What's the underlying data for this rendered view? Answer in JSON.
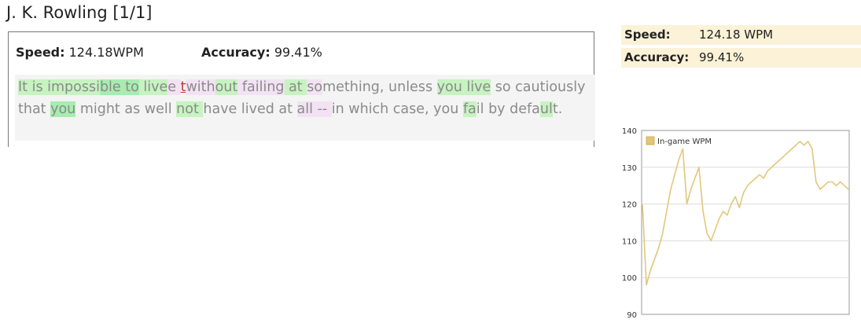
{
  "page": {
    "title": "J. K. Rowling [1/1]"
  },
  "result_panel": {
    "speed_label": "Speed:",
    "speed_value": "124.18WPM",
    "accuracy_label": "Accuracy:",
    "accuracy_value": "99.41%",
    "text_segments": [
      {
        "t": "It is impossi",
        "c": "g"
      },
      {
        "t": "ble to",
        "c": "g2"
      },
      {
        "t": " live",
        "c": "g"
      },
      {
        "t": "e ",
        "c": "p"
      },
      {
        "t": "t",
        "c": "caret"
      },
      {
        "t": "with",
        "c": "p"
      },
      {
        "t": "out",
        "c": "g"
      },
      {
        "t": " failing",
        "c": "p"
      },
      {
        "t": " at ",
        "c": "g"
      },
      {
        "t": "so",
        "c": "p"
      },
      {
        "t": "mething, unless ",
        "c": ""
      },
      {
        "t": "you live",
        "c": "g"
      },
      {
        "t": " so cautiously that ",
        "c": ""
      },
      {
        "t": "you",
        "c": "g2"
      },
      {
        "t": " might as well ",
        "c": ""
      },
      {
        "t": "not ",
        "c": "g"
      },
      {
        "t": "have lived at ",
        "c": ""
      },
      {
        "t": "all -- ",
        "c": "p"
      },
      {
        "t": "in which case, you ",
        "c": ""
      },
      {
        "t": "fa",
        "c": "g"
      },
      {
        "t": "il by ",
        "c": ""
      },
      {
        "t": "defa",
        "c": ""
      },
      {
        "t": "ul",
        "c": "g"
      },
      {
        "t": "t.",
        "c": ""
      }
    ]
  },
  "summary": {
    "speed_label": "Speed:",
    "speed_value": "124.18 WPM",
    "accuracy_label": "Accuracy:",
    "accuracy_value": "99.41%"
  },
  "chart_data": {
    "type": "line",
    "title": "",
    "xlabel": "",
    "ylabel": "",
    "ylim": [
      90,
      140
    ],
    "yticks": [
      90,
      100,
      110,
      120,
      130,
      140
    ],
    "grid": true,
    "legend": "top-left",
    "series": [
      {
        "name": "In-game WPM",
        "color": "#e2c77a",
        "values": [
          120,
          98,
          102,
          105,
          108,
          112,
          118,
          124,
          128,
          132,
          135,
          120,
          124,
          127,
          130,
          118,
          112,
          110,
          113,
          116,
          118,
          117,
          120,
          122,
          119,
          123,
          125,
          126,
          127,
          128,
          127,
          129,
          130,
          131,
          132,
          133,
          134,
          135,
          136,
          137,
          136,
          137,
          135,
          126,
          124,
          125,
          126,
          126,
          125,
          126,
          125,
          124
        ]
      }
    ]
  }
}
